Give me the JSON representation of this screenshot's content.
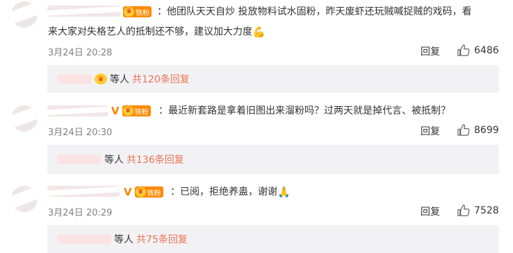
{
  "comments": [
    {
      "text_line1": "：他团队天天自炒 投放物料试水固粉，昨天废虾还玩贼喊捉贼的戏码，看",
      "text_line2": "来大家对失格艺人的抵制还不够，建议加大力度",
      "emoji": "💪",
      "time": "3月24日 20:28",
      "reply_label": "回复",
      "likes": "6486",
      "fan_badge": "铁粉",
      "reply_people": "等人",
      "reply_more": "共120条回复"
    },
    {
      "text_line1": "：最近新套路是拿着旧图出来溜粉吗？过两天就是掉代言、被抵制？",
      "time": "3月24日 20:30",
      "reply_label": "回复",
      "likes": "8699",
      "fan_badge": "铁粉",
      "reply_people": "等人",
      "reply_more": "共136条回复"
    },
    {
      "text_line1": "：已阅，拒绝养蛊，谢谢",
      "emoji": "🙏",
      "time": "3月24日 20:29",
      "reply_label": "回复",
      "likes": "7528",
      "fan_badge": "铁粉",
      "reply_people": "等人",
      "reply_more": "共75条回复"
    }
  ],
  "colors": {
    "accent": "#eb7350",
    "badge": "#ff8a00",
    "vip": "#ff8200",
    "reply_bg": "#f2f2f5"
  },
  "icons": {
    "like": "thumbs-up-icon",
    "vip": "vip-v-icon",
    "fan": "crown-icon"
  }
}
